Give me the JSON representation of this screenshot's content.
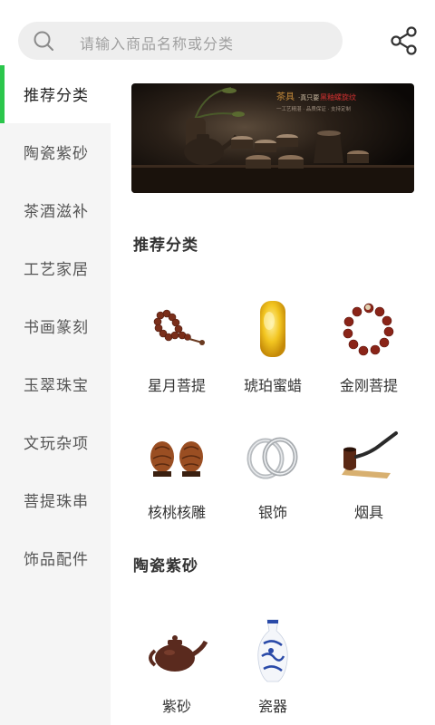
{
  "search": {
    "placeholder": "请输入商品名称或分类"
  },
  "sidebar": {
    "items": [
      {
        "label": "推荐分类",
        "active": true
      },
      {
        "label": "陶瓷紫砂"
      },
      {
        "label": "茶酒滋补"
      },
      {
        "label": "工艺家居"
      },
      {
        "label": "书画篆刻"
      },
      {
        "label": "玉翠珠宝"
      },
      {
        "label": "文玩杂项"
      },
      {
        "label": "菩提珠串"
      },
      {
        "label": "饰品配件"
      }
    ]
  },
  "banner": {
    "title": "茶具",
    "subtitle": "·真只要",
    "highlight": "黑釉螺旋纹",
    "tagline": "一工艺精湛 · 品质保证 · 支持定制"
  },
  "sections": [
    {
      "title": "推荐分类",
      "items": [
        {
          "label": "星月菩提",
          "icon": "prayer-beads-icon"
        },
        {
          "label": "琥珀蜜蜡",
          "icon": "amber-pendant-icon"
        },
        {
          "label": "金刚菩提",
          "icon": "bead-bracelet-icon"
        },
        {
          "label": "核桃核雕",
          "icon": "walnut-icon"
        },
        {
          "label": "银饰",
          "icon": "silver-rings-icon"
        },
        {
          "label": "烟具",
          "icon": "tobacco-pipe-icon"
        }
      ]
    },
    {
      "title": "陶瓷紫砂",
      "items": [
        {
          "label": "紫砂",
          "icon": "teapot-icon"
        },
        {
          "label": "瓷器",
          "icon": "porcelain-vase-icon"
        }
      ]
    }
  ],
  "colors": {
    "accent": "#2bc64c",
    "sidebar_bg": "#f5f5f5",
    "search_bg": "#eeeeee"
  }
}
